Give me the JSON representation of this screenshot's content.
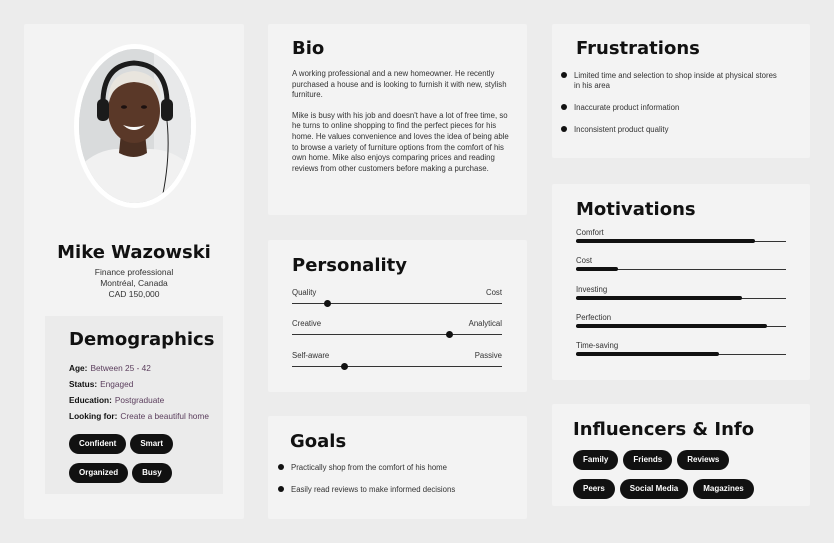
{
  "profile": {
    "name": "Mike Wazowski",
    "occupation": "Finance professional",
    "location": "Montréal, Canada",
    "income": "CAD 150,000"
  },
  "demographics": {
    "title": "Demographics",
    "rows": [
      {
        "key": "Age:",
        "value": "Between 25 - 42"
      },
      {
        "key": "Status:",
        "value": "Engaged"
      },
      {
        "key": "Education:",
        "value": "Postgraduate"
      },
      {
        "key": "Looking for:",
        "value": "Create a beautiful home"
      }
    ],
    "tags": [
      "Confident",
      "Smart",
      "Organized",
      "Busy"
    ]
  },
  "bio": {
    "title": "Bio",
    "paragraphs": [
      "A working professional and a new homeowner. He recently purchased a house and is looking to furnish it with new, stylish furniture.",
      "Mike is busy with his job and doesn't have a lot of free time, so he turns to online shopping to find the perfect pieces for his home. He values convenience and loves the idea of being able to browse a variety of furniture options from the comfort of his own home. Mike also enjoys comparing prices and reading reviews from other customers before making a purchase."
    ]
  },
  "personality": {
    "title": "Personality",
    "traits": [
      {
        "left": "Quality",
        "right": "Cost",
        "value": 0.17
      },
      {
        "left": "Creative",
        "right": "Analytical",
        "value": 0.75
      },
      {
        "left": "Self-aware",
        "right": "Passive",
        "value": 0.25
      }
    ]
  },
  "goals": {
    "title": "Goals",
    "items": [
      "Practically shop from the comfort of his home",
      "Easily read reviews to make informed decisions"
    ]
  },
  "frustrations": {
    "title": "Frustrations",
    "items": [
      "Limited time and selection to shop inside at physical stores in his area",
      "Inaccurate product information",
      "Inconsistent product quality"
    ]
  },
  "motivations": {
    "title": "Motivations",
    "items": [
      {
        "label": "Comfort",
        "value": 0.85
      },
      {
        "label": "Cost",
        "value": 0.2
      },
      {
        "label": "Investing",
        "value": 0.79
      },
      {
        "label": "Perfection",
        "value": 0.91
      },
      {
        "label": "Time-saving",
        "value": 0.68
      }
    ]
  },
  "influencers": {
    "title": "Influencers & Info",
    "tags": [
      "Family",
      "Friends",
      "Reviews",
      "Peers",
      "Social Media",
      "Magazines"
    ]
  }
}
